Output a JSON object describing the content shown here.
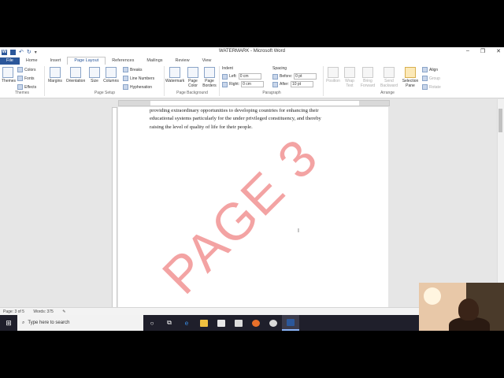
{
  "window": {
    "title": "WATERMARK - Microsoft Word"
  },
  "tabs": [
    "File",
    "Home",
    "Insert",
    "Page Layout",
    "References",
    "Mailings",
    "Review",
    "View"
  ],
  "active_tab": "Page Layout",
  "ribbon": {
    "themes": {
      "themes_label": "Themes",
      "colors": "Colors",
      "fonts": "Fonts",
      "effects": "Effects",
      "group": "Themes"
    },
    "page_setup": {
      "margins": "Margins",
      "orientation": "Orientation",
      "size": "Size",
      "columns": "Columns",
      "breaks": "Breaks",
      "line_numbers": "Line Numbers",
      "hyphenation": "Hyphenation",
      "group": "Page Setup"
    },
    "page_background": {
      "watermark": "Watermark",
      "page_color": "Page Color",
      "page_borders": "Page Borders",
      "group": "Page Background"
    },
    "paragraph": {
      "indent": "Indent",
      "left_label": "Left:",
      "left_value": "0 cm",
      "right_label": "Right:",
      "right_value": "0 cm",
      "spacing": "Spacing",
      "before_label": "Before:",
      "before_value": "0 pt",
      "after_label": "After:",
      "after_value": "10 pt",
      "group": "Paragraph"
    },
    "arrange": {
      "position": "Position",
      "wrap_text": "Wrap Text",
      "bring_forward": "Bring Forward",
      "send_backward": "Send Backward",
      "selection_pane": "Selection Pane",
      "align": "Align",
      "group_btn": "Group",
      "rotate": "Rotate",
      "group": "Arrange"
    }
  },
  "document": {
    "lines": [
      "providing extraordinary opportunities to developing countries for enhancing their",
      "educational systems particularly for the under privileged constituency, and thereby",
      "raising the level of quality of life for their people."
    ],
    "watermark": "PAGE 3"
  },
  "status": {
    "page": "Page: 3 of 5",
    "words": "Words: 375"
  },
  "taskbar": {
    "search_placeholder": "Type here to search"
  },
  "colors": {
    "word_blue": "#2b579a",
    "watermark_red": "#f3a3a3"
  }
}
